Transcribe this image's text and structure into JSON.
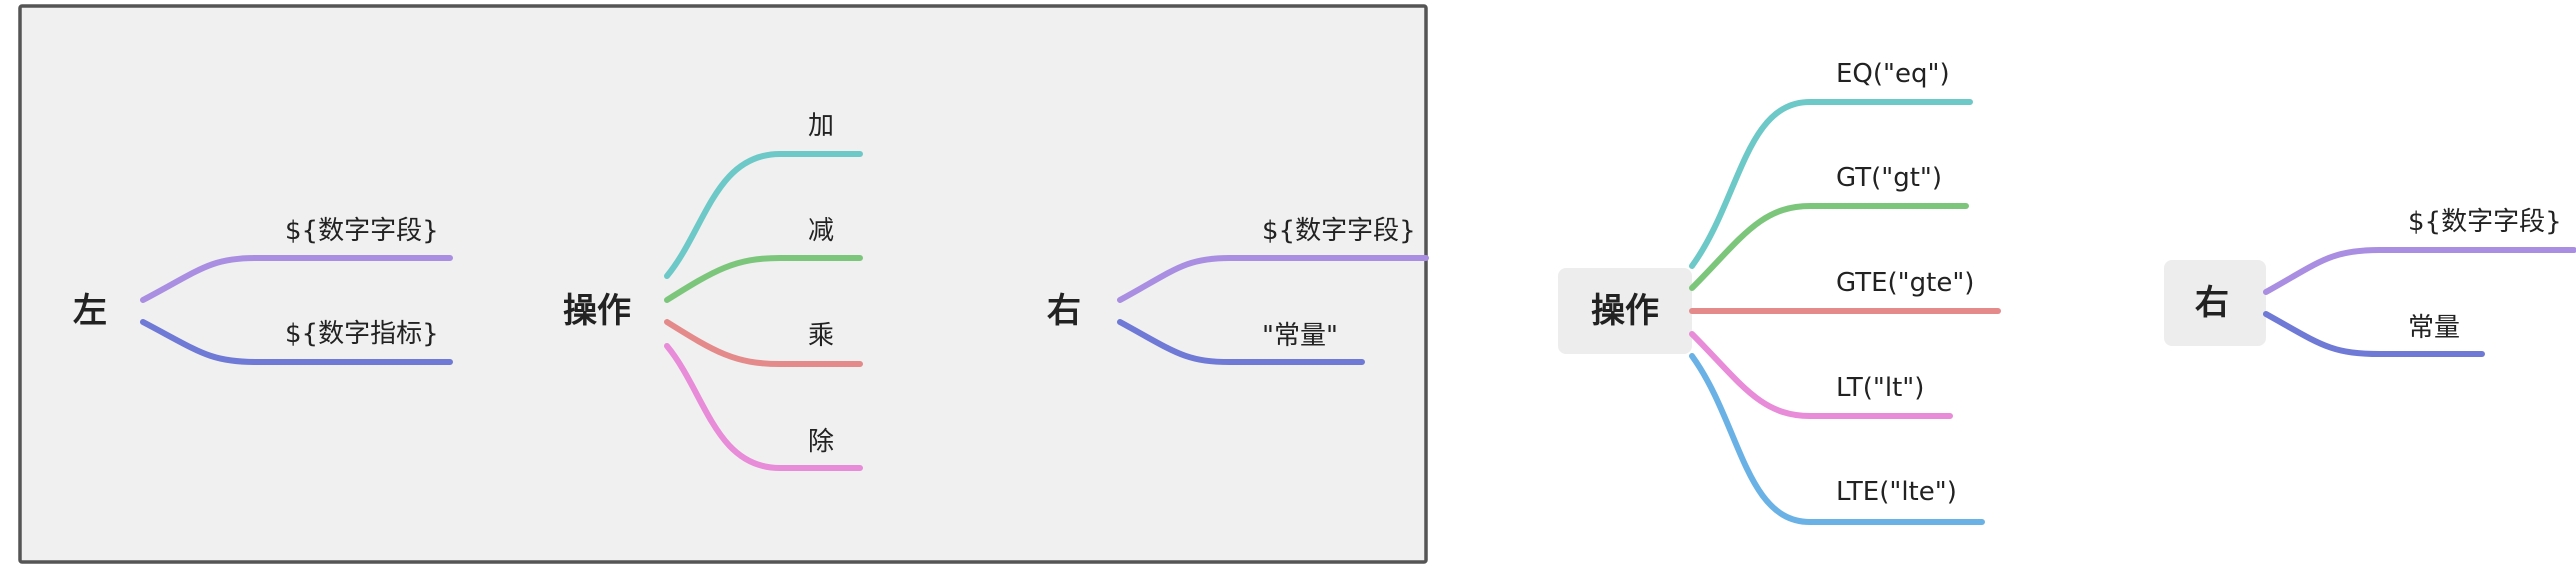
{
  "framed_group": {
    "left_map": {
      "root": "左",
      "leaves": [
        {
          "label": "${数字字段}",
          "color": "#a98ee2"
        },
        {
          "label": "${数字指标}",
          "color": "#6f79d6"
        }
      ]
    },
    "op_map": {
      "root": "操作",
      "leaves": [
        {
          "label": "加",
          "color": "#6cc9c7"
        },
        {
          "label": "减",
          "color": "#7cc67c"
        },
        {
          "label": "乘",
          "color": "#e48a8a"
        },
        {
          "label": "除",
          "color": "#e88bd8"
        }
      ]
    },
    "right_map": {
      "root": "右",
      "leaves": [
        {
          "label": "${数字字段}",
          "color": "#a98ee2"
        },
        {
          "label": "\"常量\"",
          "color": "#6f79d6"
        }
      ]
    }
  },
  "compare_map": {
    "root": "操作",
    "leaves": [
      {
        "label": "EQ(\"eq\")",
        "color": "#6cc9c7"
      },
      {
        "label": "GT(\"gt\")",
        "color": "#7cc67c"
      },
      {
        "label": "GTE(\"gte\")",
        "color": "#e48a8a"
      },
      {
        "label": "LT(\"lt\")",
        "color": "#e88bd8"
      },
      {
        "label": "LTE(\"lte\")",
        "color": "#6ab2e6"
      }
    ]
  },
  "value_map": {
    "root": "右",
    "leaves": [
      {
        "label": "${数字字段}",
        "color": "#a98ee2"
      },
      {
        "label": "常量",
        "color": "#6f79d6"
      }
    ]
  }
}
